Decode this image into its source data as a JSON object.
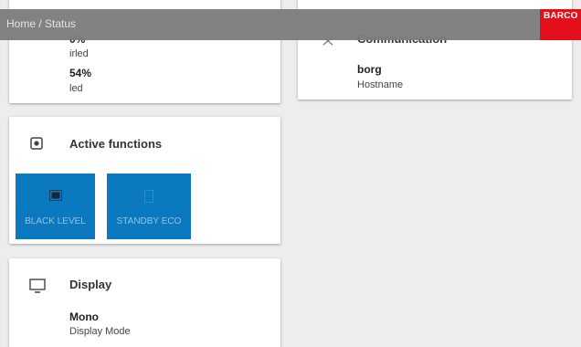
{
  "header": {
    "breadcrumb": "Home / Status",
    "brand": "BARCO"
  },
  "leds_card": {
    "partial_value": "0%",
    "partial_label": "irled",
    "value": "54%",
    "label": "led"
  },
  "communication_card": {
    "title": "Communication",
    "icon": "communication-icon",
    "hostname_value": "borg",
    "hostname_label": "Hostname"
  },
  "functions_card": {
    "title": "Active functions",
    "icon": "functions-icon",
    "buttons": [
      {
        "label": "BLACK LEVEL",
        "icon": "black-level-icon"
      },
      {
        "label": "STANDBY ECO",
        "icon": "standby-eco-icon"
      }
    ]
  },
  "display_card": {
    "title": "Display",
    "icon": "monitor-icon",
    "mode_value": "Mono",
    "mode_label": "Display Mode"
  },
  "colors": {
    "accent": "#0b79bf",
    "brand": "#e30613",
    "header": "#7d7d7d",
    "background": "#ededed"
  }
}
